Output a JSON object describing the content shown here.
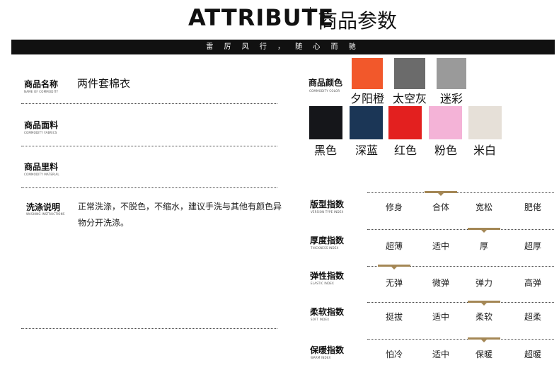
{
  "header": {
    "title_en": "ATTRIBUTE",
    "title_cn": "商品参数",
    "banner": "雷 厉 风 行 ， 随 心 而 驰"
  },
  "left": {
    "name": {
      "label": "商品名称",
      "sub": "NAME OF COMMODITY",
      "value": "两件套棉衣"
    },
    "fabric": {
      "label": "商品面料",
      "sub": "COMMODITY FABRICS",
      "value": ""
    },
    "lining": {
      "label": "商品里料",
      "sub": "COMMODITY MATERIAL",
      "value": ""
    },
    "wash": {
      "label": "洗涤说明",
      "sub": "WASHING INSTRUCTIONS",
      "value": "正常洗涤，不脱色，不缩水，建议手洗与其他有颜色异物分开洗涤。"
    }
  },
  "colors": {
    "label": "商品颜色",
    "sub": "COMMODITY COLOR",
    "items": [
      {
        "name": "夕阳橙",
        "color": "#f2582b"
      },
      {
        "name": "太空灰",
        "color": "#6b6b6b"
      },
      {
        "name": "迷彩",
        "color": "#9a9a9a"
      },
      {
        "name": "黑色",
        "color": "#15161a"
      },
      {
        "name": "深蓝",
        "color": "#1b3656"
      },
      {
        "name": "红色",
        "color": "#e3201f"
      },
      {
        "name": "粉色",
        "color": "#f4b3d7"
      },
      {
        "name": "米白",
        "color": "#e6e0d8"
      }
    ]
  },
  "indices": [
    {
      "label": "版型指数",
      "sub": "VERSION TYPE INDEX",
      "options": [
        "修身",
        "合体",
        "宽松",
        "肥佬"
      ],
      "selected": 1
    },
    {
      "label": "厚度指数",
      "sub": "THICKNESS INDEX",
      "options": [
        "超薄",
        "适中",
        "厚",
        "超厚"
      ],
      "selected": 2
    },
    {
      "label": "弹性指数",
      "sub": "ELASTIC INDEX",
      "options": [
        "无弹",
        "微弹",
        "弹力",
        "高弹"
      ],
      "selected": 0
    },
    {
      "label": "柔软指数",
      "sub": "SOFT INDEX",
      "options": [
        "挺拔",
        "适中",
        "柔软",
        "超柔"
      ],
      "selected": 2
    },
    {
      "label": "保暖指数",
      "sub": "WARM INDEX",
      "options": [
        "怕冷",
        "适中",
        "保暖",
        "超暖"
      ],
      "selected": 2
    }
  ]
}
